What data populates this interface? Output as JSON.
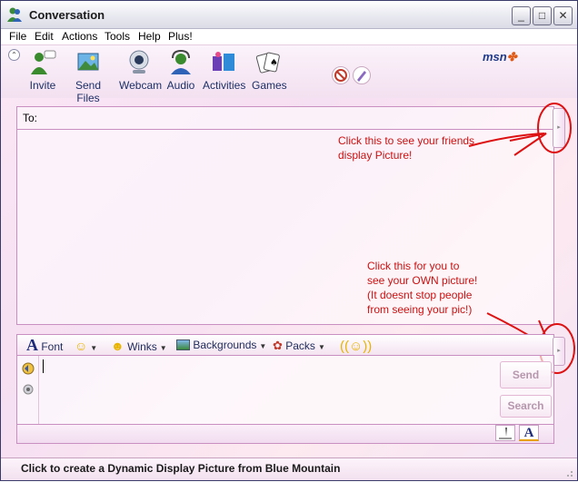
{
  "window": {
    "title": "Conversation",
    "minimize": "_",
    "maximize": "□",
    "close": "✕"
  },
  "menu": [
    "File",
    "Edit",
    "Actions",
    "Tools",
    "Help",
    "Plus!"
  ],
  "toolbar": {
    "items": [
      {
        "label": "Invite",
        "icon": "invite-icon"
      },
      {
        "label": "Send Files",
        "icon": "send-files-icon"
      },
      {
        "label": "Webcam",
        "icon": "webcam-icon"
      },
      {
        "label": "Audio",
        "icon": "audio-icon"
      },
      {
        "label": "Activities",
        "icon": "activities-icon"
      },
      {
        "label": "Games",
        "icon": "games-icon"
      }
    ],
    "logo_main": "msn",
    "logo_accent": "✤"
  },
  "to": {
    "label": "To:"
  },
  "annotations": {
    "top": [
      "Click this to see your friends",
      "display Picture!"
    ],
    "bottom": [
      "Click this for you to",
      "see your OWN picture!",
      "(It doesnt stop people",
      "from seeing your pic!)"
    ]
  },
  "format_bar": {
    "font": "Font",
    "winks": "Winks",
    "backgrounds": "Backgrounds",
    "packs": "Packs"
  },
  "buttons": {
    "send": "Send",
    "search": "Search"
  },
  "status": "Click to create a Dynamic Display Picture from Blue Mountain",
  "colors": {
    "annotation_red": "#cc1111",
    "panel_border": "#c88fc0",
    "pink_bg": "#fbe8f5"
  }
}
